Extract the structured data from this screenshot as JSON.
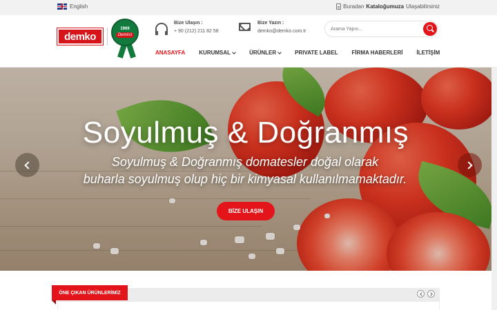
{
  "topbar": {
    "language": "English",
    "catalog_prefix": "Buradan",
    "catalog_strong": "Kataloğumuza",
    "catalog_suffix": "Ulaşabilirsiniz"
  },
  "header": {
    "logo_text": "demko",
    "badge_year": "1969",
    "badge_name": "Demirci",
    "phone": {
      "title": "Bize Ulaşın :",
      "value": "+ 90 (212) 211 82 58",
      "icon": "headset-icon"
    },
    "email": {
      "title": "Bize Yazın :",
      "value": "demko@demko.com.tr",
      "icon": "envelope-icon"
    },
    "search_placeholder": "Arama Yapın...",
    "nav": [
      {
        "label": "ANASAYFA",
        "active": true,
        "dropdown": false
      },
      {
        "label": "KURUMSAL",
        "active": false,
        "dropdown": true
      },
      {
        "label": "ÜRÜNLER",
        "active": false,
        "dropdown": true
      },
      {
        "label": "PRIVATE LABEL",
        "active": false,
        "dropdown": false
      },
      {
        "label": "FİRMA HABERLERİ",
        "active": false,
        "dropdown": false
      },
      {
        "label": "İLETİŞİM",
        "active": false,
        "dropdown": false
      }
    ]
  },
  "hero": {
    "title": "Soyulmuş & Doğranmış",
    "subtitle_line1": "Soyulmuş & Doğranmış domatesler doğal olarak",
    "subtitle_line2": "buharla soyulmuş olup hiç bir kimyasal kullanılmamaktadır.",
    "button_label": "BİZE ULAŞIN"
  },
  "featured": {
    "tab_label": "ÖNE ÇIKAN ÜRÜNLERİMİZ"
  },
  "colors": {
    "brand_red": "#e3151b",
    "badge_green": "#127a3d",
    "topbar_bg": "#f2f2f2"
  }
}
